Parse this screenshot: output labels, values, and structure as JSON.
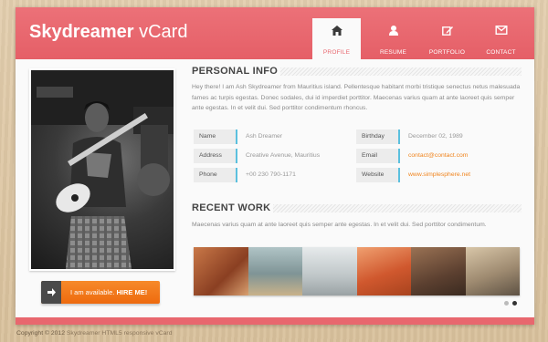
{
  "header": {
    "brand_bold": "Skydreamer",
    "brand_rest": " vCard"
  },
  "nav": [
    {
      "label": "PROFILE",
      "icon": "home-icon",
      "active": true
    },
    {
      "label": "RESUME",
      "icon": "user-icon",
      "active": false
    },
    {
      "label": "PORTFOLIO",
      "icon": "edit-icon",
      "active": false
    },
    {
      "label": "CONTACT",
      "icon": "mail-icon",
      "active": false
    }
  ],
  "hire": {
    "prefix": "I am available.",
    "action": "HIRE ME!"
  },
  "personal_info": {
    "title": "PERSONAL INFO",
    "intro": "Hey there! I am Ash Skydreamer from Mauritius island. Pellentesque habitant morbi tristique senectus netus malesuada fames ac turpis egestas. Donec sodales, dui id imperdiet porttitor. Maecenas varius quam at ante laoreet quis semper ante egestas. In et velit dui. Sed porttitor condimentum rhoncus.",
    "fields_left": [
      {
        "key": "Name",
        "value": "Ash Dreamer"
      },
      {
        "key": "Address",
        "value": "Creative Avenue, Mauritius"
      },
      {
        "key": "Phone",
        "value": "+00 230 790-1171"
      }
    ],
    "fields_right": [
      {
        "key": "Birthday",
        "value": "December 02, 1989"
      },
      {
        "key": "Email",
        "value": "contact@contact.com"
      },
      {
        "key": "Website",
        "value": "www.simplesphere.net"
      }
    ]
  },
  "recent_work": {
    "title": "RECENT WORK",
    "description": "Maecenas varius quam at ante laoreet quis semper ante egestas. In et velit dui. Sed porttitor condimentum."
  },
  "gallery_colors": [
    "#b9603a",
    "#8fa3a6",
    "#c9cfd0",
    "#d7663d",
    "#6f4e3c",
    "#b8a58e"
  ],
  "slider": {
    "pages": 2,
    "active": 2
  },
  "colors": {
    "accent": "#e8676e",
    "button": "#f47b1c",
    "link": "#f0841d",
    "key_border": "#5bc0de"
  },
  "footer": {
    "copyright": "Copyright © 2012",
    "credit": "Skydreamer HTML5 responsive vCard"
  }
}
